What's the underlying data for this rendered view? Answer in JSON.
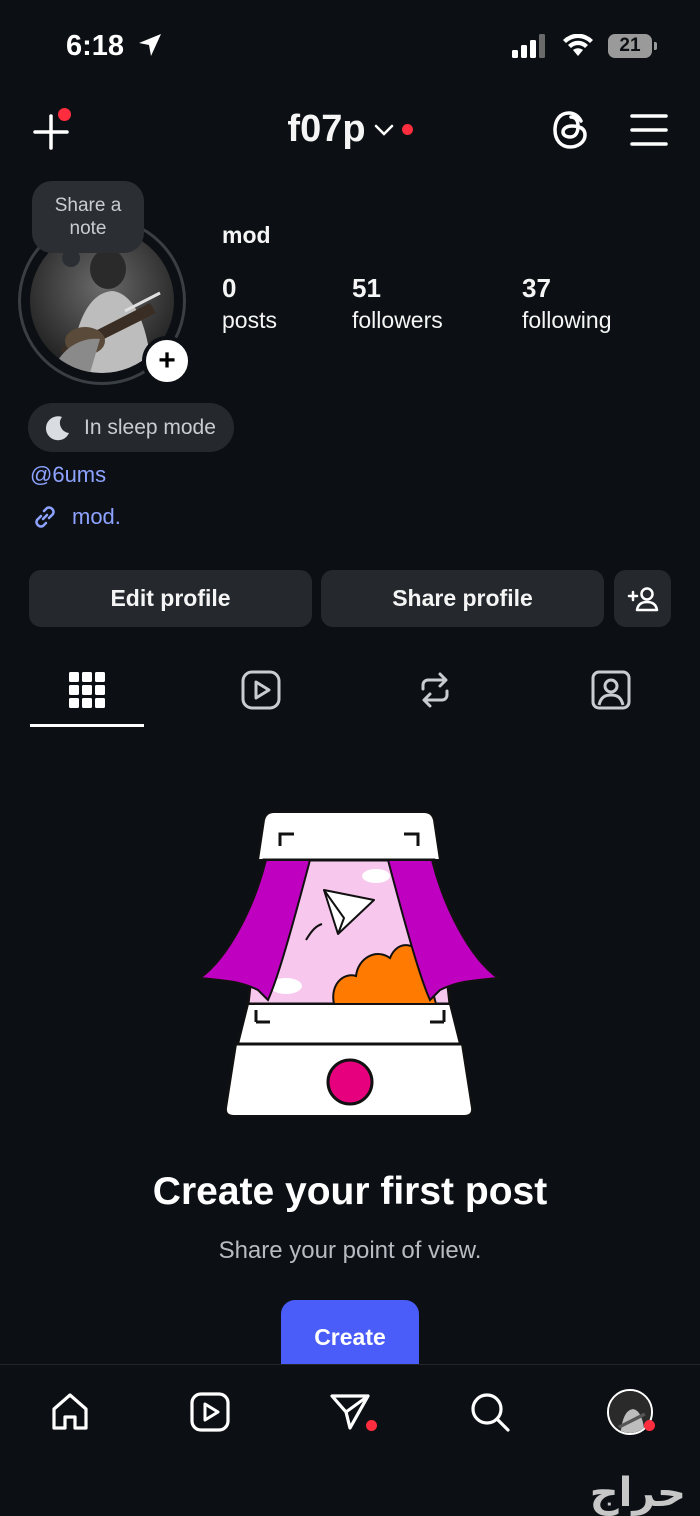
{
  "status_bar": {
    "time": "6:18",
    "battery": "21"
  },
  "header": {
    "username": "f07p"
  },
  "note": {
    "text": "Share a note"
  },
  "profile": {
    "display_name": "mod",
    "stats": [
      {
        "value": "0",
        "label": "posts"
      },
      {
        "value": "51",
        "label": "followers"
      },
      {
        "value": "37",
        "label": "following"
      }
    ],
    "sleep_status": "In sleep mode",
    "handle": "@6ums",
    "link": "mod."
  },
  "actions": {
    "edit": "Edit profile",
    "share": "Share profile"
  },
  "tabs": [
    "grid-icon",
    "reels-icon",
    "reposts-icon",
    "tagged-icon"
  ],
  "empty_state": {
    "title": "Create your first post",
    "subtitle": "Share your point of view.",
    "button": "Create"
  },
  "watermark": "حراج",
  "colors": {
    "accent": "#4a5df9",
    "link": "#8ea2ff",
    "notification": "#ff2d3d",
    "background": "#0c1014"
  }
}
